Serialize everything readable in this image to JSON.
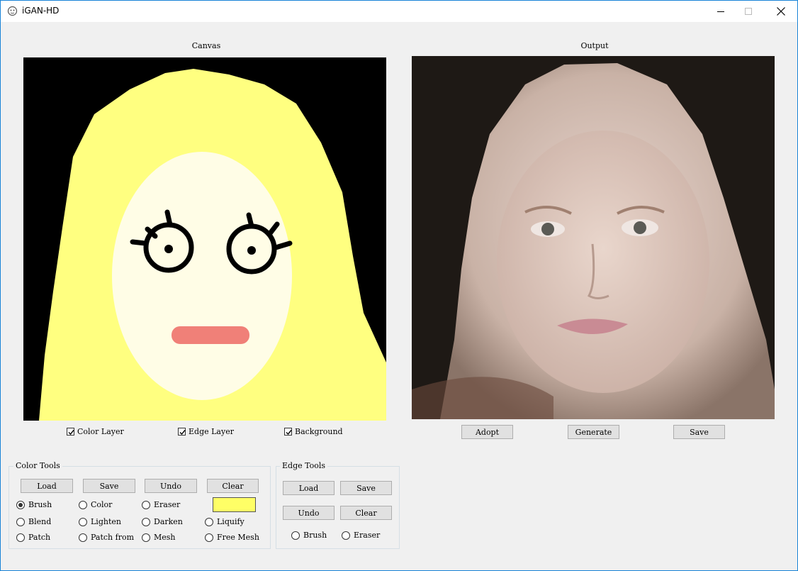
{
  "window": {
    "title": "iGAN-HD",
    "icon": "app-logo-icon",
    "controls": [
      "minimize-icon",
      "maximize-icon",
      "close-icon"
    ]
  },
  "canvas_panel": {
    "label": "Canvas",
    "layers": [
      {
        "label": "Color Layer",
        "checked": true
      },
      {
        "label": "Edge Layer",
        "checked": true
      },
      {
        "label": "Background",
        "checked": true
      }
    ],
    "colors": {
      "background": "#000000",
      "hair": "#ffff80",
      "face": "#fffde6",
      "lips": "#f08078",
      "edges": "#000000"
    }
  },
  "output_panel": {
    "label": "Output",
    "buttons": {
      "adopt": "Adopt",
      "generate": "Generate",
      "save": "Save"
    }
  },
  "color_tools": {
    "title": "Color Tools",
    "buttons": {
      "load": "Load",
      "save": "Save",
      "undo": "Undo",
      "clear": "Clear"
    },
    "current_color": "#ffff66",
    "modes": [
      {
        "label": "Brush",
        "selected": true
      },
      {
        "label": "Color",
        "selected": false
      },
      {
        "label": "Eraser",
        "selected": false
      },
      {
        "label": "Blend",
        "selected": false
      },
      {
        "label": "Lighten",
        "selected": false
      },
      {
        "label": "Darken",
        "selected": false
      },
      {
        "label": "Liquify",
        "selected": false
      },
      {
        "label": "Patch",
        "selected": false
      },
      {
        "label": "Patch from",
        "selected": false
      },
      {
        "label": "Mesh",
        "selected": false
      },
      {
        "label": "Free Mesh",
        "selected": false
      }
    ]
  },
  "edge_tools": {
    "title": "Edge Tools",
    "buttons": {
      "load": "Load",
      "save": "Save",
      "undo": "Undo",
      "clear": "Clear"
    },
    "modes": [
      {
        "label": "Brush",
        "selected": false
      },
      {
        "label": "Eraser",
        "selected": false
      }
    ]
  }
}
